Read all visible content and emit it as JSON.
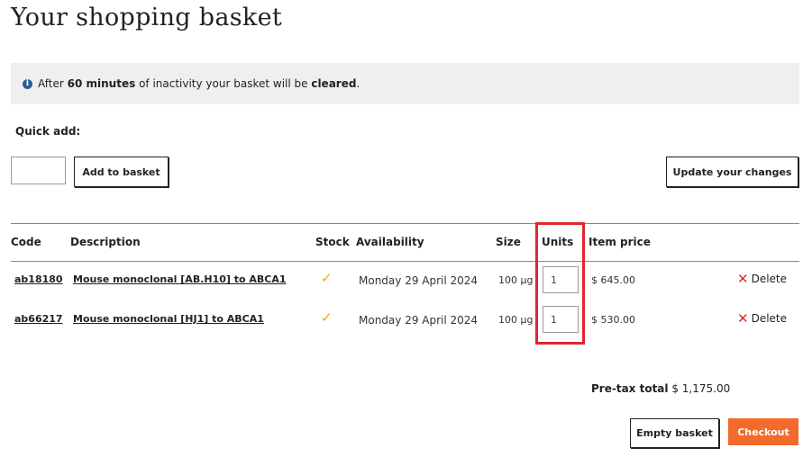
{
  "page": {
    "title": "Your shopping basket"
  },
  "info": {
    "prefix": "After ",
    "minutes": "60 minutes",
    "middle": " of inactivity your basket will be ",
    "cleared": "cleared",
    "suffix": ".",
    "icon": "info-icon"
  },
  "quick_add": {
    "label": "Quick add:",
    "input_value": "",
    "add_button": "Add to basket"
  },
  "update_button": "Update your changes",
  "table": {
    "headers": {
      "code": "Code",
      "description": "Description",
      "stock": "Stock",
      "availability": "Availability",
      "size": "Size",
      "units": "Units",
      "item_price": "Item price"
    },
    "rows": [
      {
        "code": "ab18180",
        "description": "Mouse monoclonal [AB.H10] to ABCA1",
        "stock_icon": "checkmark-icon",
        "stock_mark": "✓",
        "availability": "Monday 29 April 2024",
        "size": "100 µg",
        "units": "1",
        "price": "$ 645.00",
        "delete_mark": "✕",
        "delete_label": "Delete"
      },
      {
        "code": "ab66217",
        "description": "Mouse monoclonal [HJ1] to ABCA1",
        "stock_icon": "checkmark-icon",
        "stock_mark": "✓",
        "availability": "Monday 29 April 2024",
        "size": "100 µg",
        "units": "1",
        "price": "$ 530.00",
        "delete_mark": "✕",
        "delete_label": "Delete"
      }
    ]
  },
  "summary": {
    "total_label": "Pre-tax total",
    "total_value": "$ 1,175.00"
  },
  "actions": {
    "empty_button": "Empty basket",
    "checkout_button": "Checkout"
  },
  "colors": {
    "accent": "#f26b2a",
    "highlight": "#e0262f",
    "stock": "#f3a20c",
    "info_bg": "#eef0ef"
  }
}
